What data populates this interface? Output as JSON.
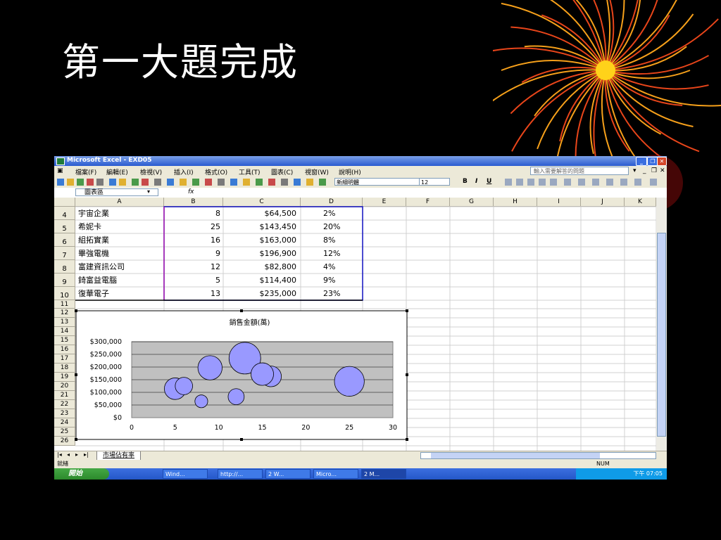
{
  "slide": {
    "title": "第一大題完成"
  },
  "excel": {
    "window_title": "Microsoft Excel - EXD05",
    "menu": [
      "檔案(F)",
      "編輯(E)",
      "檢視(V)",
      "插入(I)",
      "格式(O)",
      "工具(T)",
      "圖表(C)",
      "視窗(W)",
      "說明(H)"
    ],
    "help_placeholder": "輸入需要解答的問題",
    "toolbar": {
      "font_name": "新細明體",
      "font_size": "12",
      "bold": "B",
      "italic": "I",
      "underline": "U"
    },
    "name_box": "圖表區",
    "fx_label": "fx",
    "columns": [
      "A",
      "B",
      "C",
      "D",
      "E",
      "F",
      "G",
      "H",
      "I",
      "J",
      "K"
    ],
    "rows": [
      {
        "num": "4",
        "name": "宇宙企業",
        "b": "8",
        "c": "$64,500",
        "d": "2%"
      },
      {
        "num": "5",
        "name": "希妮卡",
        "b": "25",
        "c": "$143,450",
        "d": "20%"
      },
      {
        "num": "6",
        "name": "組拓實業",
        "b": "16",
        "c": "$163,000",
        "d": "8%"
      },
      {
        "num": "7",
        "name": "畢強電機",
        "b": "9",
        "c": "$196,900",
        "d": "12%"
      },
      {
        "num": "8",
        "name": "富建資訊公司",
        "b": "12",
        "c": "$82,800",
        "d": "4%"
      },
      {
        "num": "9",
        "name": "錡富益電腦",
        "b": "5",
        "c": "$114,400",
        "d": "9%"
      },
      {
        "num": "10",
        "name": "復華電子",
        "b": "13",
        "c": "$235,000",
        "d": "23%"
      }
    ],
    "empty_rows": [
      "11",
      "12",
      "13",
      "14",
      "15",
      "16",
      "17",
      "18",
      "19",
      "20",
      "21",
      "22",
      "23",
      "24",
      "25",
      "26"
    ],
    "sheet_tab": "市場佔有率",
    "status_left": "就緒",
    "status_right": "NUM",
    "taskbar": {
      "start_label": "開始",
      "items": [
        "Wind...",
        "http://...",
        "2 W...",
        "Micro...",
        "2 M..."
      ],
      "clock": "下午 07:05"
    },
    "colors": {
      "bubble": "#9999ff",
      "plot_bg": "#c0c0c0",
      "accent_border": "#1010c0"
    }
  },
  "chart_data": {
    "type": "scatter",
    "title": "銷售金額(萬)",
    "x_ticks": [
      "0",
      "5",
      "10",
      "15",
      "20",
      "25",
      "30"
    ],
    "y_ticks": [
      "$300,000",
      "$250,000",
      "$200,000",
      "$150,000",
      "$100,000",
      "$50,000",
      "$0"
    ],
    "xlim": [
      0,
      30
    ],
    "ylim": [
      0,
      300000
    ],
    "grid": true,
    "points": [
      {
        "x": 8,
        "y": 64500,
        "size": 2
      },
      {
        "x": 25,
        "y": 143450,
        "size": 20
      },
      {
        "x": 16,
        "y": 163000,
        "size": 8
      },
      {
        "x": 9,
        "y": 196900,
        "size": 12
      },
      {
        "x": 12,
        "y": 82800,
        "size": 4
      },
      {
        "x": 5,
        "y": 114400,
        "size": 9
      },
      {
        "x": 13,
        "y": 235000,
        "size": 23
      },
      {
        "x": 6,
        "y": 125000,
        "size": 5
      },
      {
        "x": 15,
        "y": 172000,
        "size": 10
      }
    ]
  }
}
